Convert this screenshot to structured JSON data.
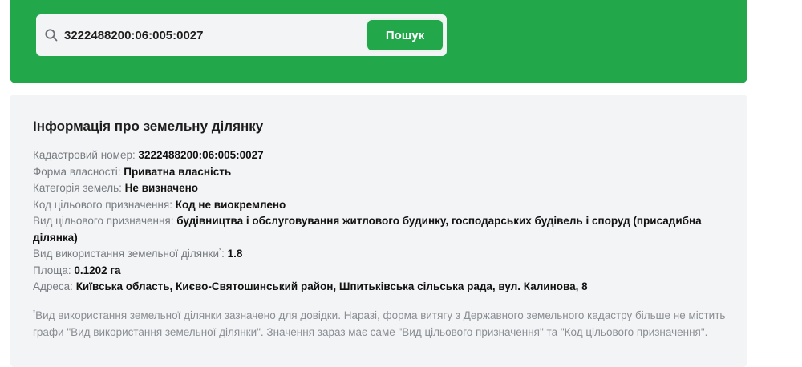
{
  "search": {
    "value": "3222488200:06:005:0027",
    "button_label": "Пошук"
  },
  "info": {
    "title": "Інформація про земельну ділянку",
    "rows": [
      {
        "label": "Кадастровий номер:",
        "value": "3222488200:06:005:0027"
      },
      {
        "label": "Форма власності:",
        "value": "Приватна власність"
      },
      {
        "label": "Категорія земель:",
        "value": "Не визначено"
      },
      {
        "label": "Код цільового призначення:",
        "value": "Код не виокремлено"
      },
      {
        "label": "Вид цільового призначення:",
        "value": "будівництва і обслуговування житлового будинку, господарських будівель і споруд (присадибна ділянка)"
      },
      {
        "label": "Вид використання земельної ділянки",
        "label_sup": "*",
        "label_suffix": ":",
        "value": "1.8"
      },
      {
        "label": "Площа:",
        "value": "0.1202 га"
      },
      {
        "label": "Адреса:",
        "value": "Київська область, Києво-Святошинський район, Шпитьківська сільська рада, вул. Калинова, 8"
      }
    ],
    "footnote_mark": "*",
    "footnote": "Вид використання земельної ділянки зазначено для довідки. Наразі, форма витягу з Державного земельного кадастру більше не містить графи \"Вид використання земельної ділянки\". Значення зараз має саме \"Вид цільового призначення\" та \"Код цільового призначення\"."
  },
  "colors": {
    "brand_green": "#22a84a",
    "card_bg": "#f3f4f6"
  },
  "icons": {
    "search": "search-icon"
  }
}
